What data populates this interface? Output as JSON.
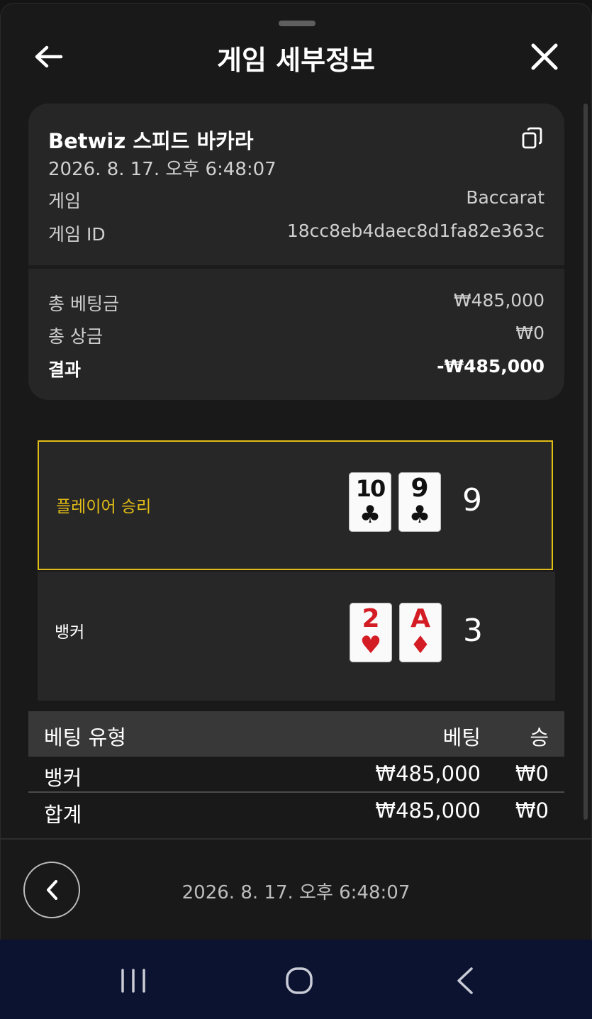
{
  "header": {
    "title": "게임 세부정보"
  },
  "summary": {
    "title": "Betwiz 스피드 바카라",
    "datetime": "2026. 8. 17. 오후 6:48:07",
    "game_label": "게임",
    "game_value": "Baccarat",
    "game_id_label": "게임 ID",
    "game_id_value": "18cc8eb4daec8d1fa82e363c",
    "total_bet_label": "총 베팅금",
    "total_bet_value": "₩485,000",
    "total_win_label": "총 상금",
    "total_win_value": "₩0",
    "result_label": "결과",
    "result_value": "-₩485,000"
  },
  "hands": {
    "player": {
      "label": "플레이어 승리",
      "cards": [
        {
          "rank": "10",
          "suit": "♣"
        },
        {
          "rank": "9",
          "suit": "♣"
        }
      ],
      "total": "9"
    },
    "banker": {
      "label": "뱅커",
      "cards": [
        {
          "rank": "2",
          "suit": "♥"
        },
        {
          "rank": "A",
          "suit": "♦"
        }
      ],
      "total": "3"
    }
  },
  "bets_table": {
    "headers": {
      "type": "베팅 유형",
      "bet": "베팅",
      "win": "승"
    },
    "rows": [
      {
        "type": "뱅커",
        "bet": "₩485,000",
        "win": "₩0"
      }
    ],
    "total": {
      "type": "합계",
      "bet": "₩485,000",
      "win": "₩0"
    }
  },
  "footer": {
    "datetime": "2026. 8. 17. 오후 6:48:07"
  },
  "colors": {
    "accent": "#e3bd17",
    "background": "#191919",
    "card_bg": "#262626",
    "nav_bg": "#0b1330"
  },
  "icons": {
    "back": "arrow-left-icon",
    "close": "close-icon",
    "copy": "copy-icon",
    "footer_back": "chevron-left-icon",
    "nav_recents": "recents-icon",
    "nav_home": "home-icon",
    "nav_back": "back-icon"
  }
}
